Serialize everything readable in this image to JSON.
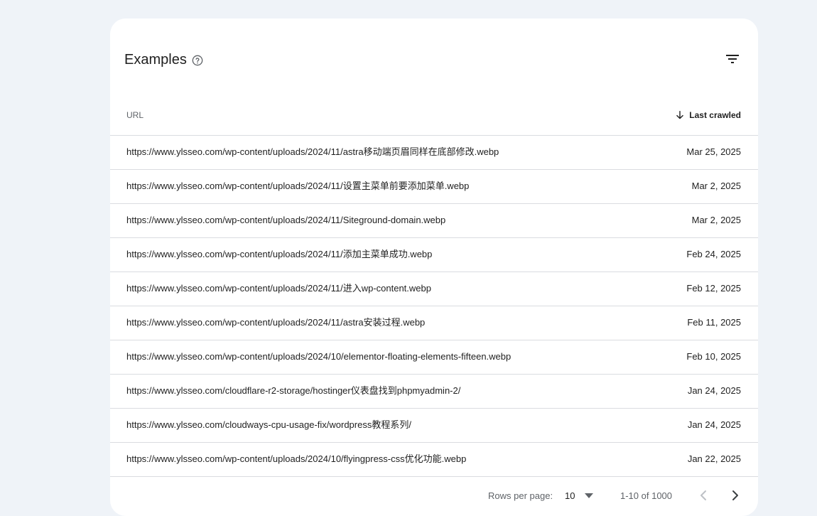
{
  "card": {
    "title": "Examples",
    "help_icon": "help-circle-icon",
    "filter_icon": "filter-icon"
  },
  "table": {
    "columns": {
      "url": "URL",
      "last_crawled": "Last crawled",
      "sort_icon": "arrow-down-icon"
    },
    "rows": [
      {
        "url": "https://www.ylsseo.com/wp-content/uploads/2024/11/astra移动端页眉同样在底部修改.webp",
        "date": "Mar 25, 2025"
      },
      {
        "url": "https://www.ylsseo.com/wp-content/uploads/2024/11/设置主菜单前要添加菜单.webp",
        "date": "Mar 2, 2025"
      },
      {
        "url": "https://www.ylsseo.com/wp-content/uploads/2024/11/Siteground-domain.webp",
        "date": "Mar 2, 2025"
      },
      {
        "url": "https://www.ylsseo.com/wp-content/uploads/2024/11/添加主菜单成功.webp",
        "date": "Feb 24, 2025"
      },
      {
        "url": "https://www.ylsseo.com/wp-content/uploads/2024/11/进入wp-content.webp",
        "date": "Feb 12, 2025"
      },
      {
        "url": "https://www.ylsseo.com/wp-content/uploads/2024/11/astra安装过程.webp",
        "date": "Feb 11, 2025"
      },
      {
        "url": "https://www.ylsseo.com/wp-content/uploads/2024/10/elementor-floating-elements-fifteen.webp",
        "date": "Feb 10, 2025"
      },
      {
        "url": "https://www.ylsseo.com/cloudflare-r2-storage/hostinger仪表盘找到phpmyadmin-2/",
        "date": "Jan 24, 2025"
      },
      {
        "url": "https://www.ylsseo.com/cloudways-cpu-usage-fix/wordpress教程系列/",
        "date": "Jan 24, 2025"
      },
      {
        "url": "https://www.ylsseo.com/wp-content/uploads/2024/10/flyingpress-css优化功能.webp",
        "date": "Jan 22, 2025"
      }
    ]
  },
  "pagination": {
    "rows_per_page_label": "Rows per page:",
    "rows_per_page_value": "10",
    "range_text": "1-10 of 1000",
    "prev_icon": "chevron-left-icon",
    "next_icon": "chevron-right-icon"
  }
}
